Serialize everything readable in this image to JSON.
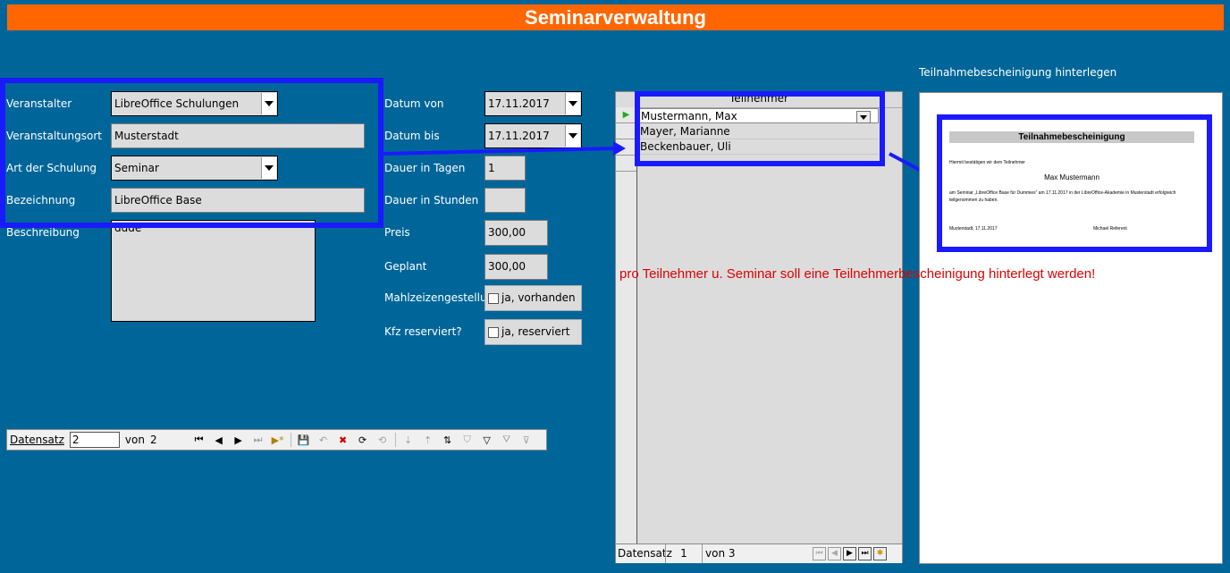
{
  "header": {
    "title": "Seminarverwaltung"
  },
  "form": {
    "veranstalter": {
      "label": "Veranstalter",
      "value": "LibreOffice Schulungen"
    },
    "ort": {
      "label": "Veranstaltungsort",
      "value": "Musterstadt"
    },
    "art": {
      "label": "Art der Schulung",
      "value": "Seminar"
    },
    "bezeichnung": {
      "label": "Bezeichnung",
      "value": "LibreOffice Base"
    },
    "beschreibung": {
      "label": "Beschreibung",
      "value": "ddde"
    },
    "datum_von": {
      "label": "Datum von",
      "value": "17.11.2017"
    },
    "datum_bis": {
      "label": "Datum bis",
      "value": "17.11.2017"
    },
    "dauer_tage": {
      "label": "Dauer in Tagen",
      "value": "1"
    },
    "dauer_stunden": {
      "label": "Dauer in Stunden",
      "value": ""
    },
    "preis": {
      "label": "Preis",
      "value": "300,00"
    },
    "geplant": {
      "label": "Geplant",
      "value": "300,00"
    },
    "mahlzeit": {
      "label": "Mahlzeizengestellu",
      "option": "ja, vorhanden",
      "checked": false
    },
    "kfz": {
      "label": "Kfz reserviert?",
      "option": "ja, reserviert",
      "checked": false
    }
  },
  "navigator": {
    "label": "Datensatz",
    "current": "2",
    "of_label": "von",
    "total": "2"
  },
  "participants": {
    "header": "Teilnehmer",
    "rows": [
      "Mustermann, Max",
      "Mayer, Marianne",
      "Beckenbauer, Uli"
    ],
    "nav": {
      "label": "Datensatz",
      "current": "1",
      "of_label": "von 3"
    }
  },
  "certificate": {
    "caption": "Teilnahmebescheinigung hinterlegen",
    "title": "Teilnahmebescheinigung",
    "intro": "Hiermit bestätigen wir dem Teilnehmer",
    "name": "Max Mustermann",
    "body": "am Seminar „LibreOffice Base für Dummies“ am 17.11.2017 in der LibreOffice-Akademie in Musterstadt erfolgreich teilgenommen zu haben.",
    "place_date": "Musterstadt, 17.11.2017",
    "signer": "Michael Referent"
  },
  "annotation": "pro Teilnehmer u. Seminar soll eine Teilnehmerbescheinigung hinterlegt werden!",
  "colors": {
    "background": "#006699",
    "banner": "#ff6600",
    "highlight": "#1a1aff",
    "note": "#e00000"
  }
}
